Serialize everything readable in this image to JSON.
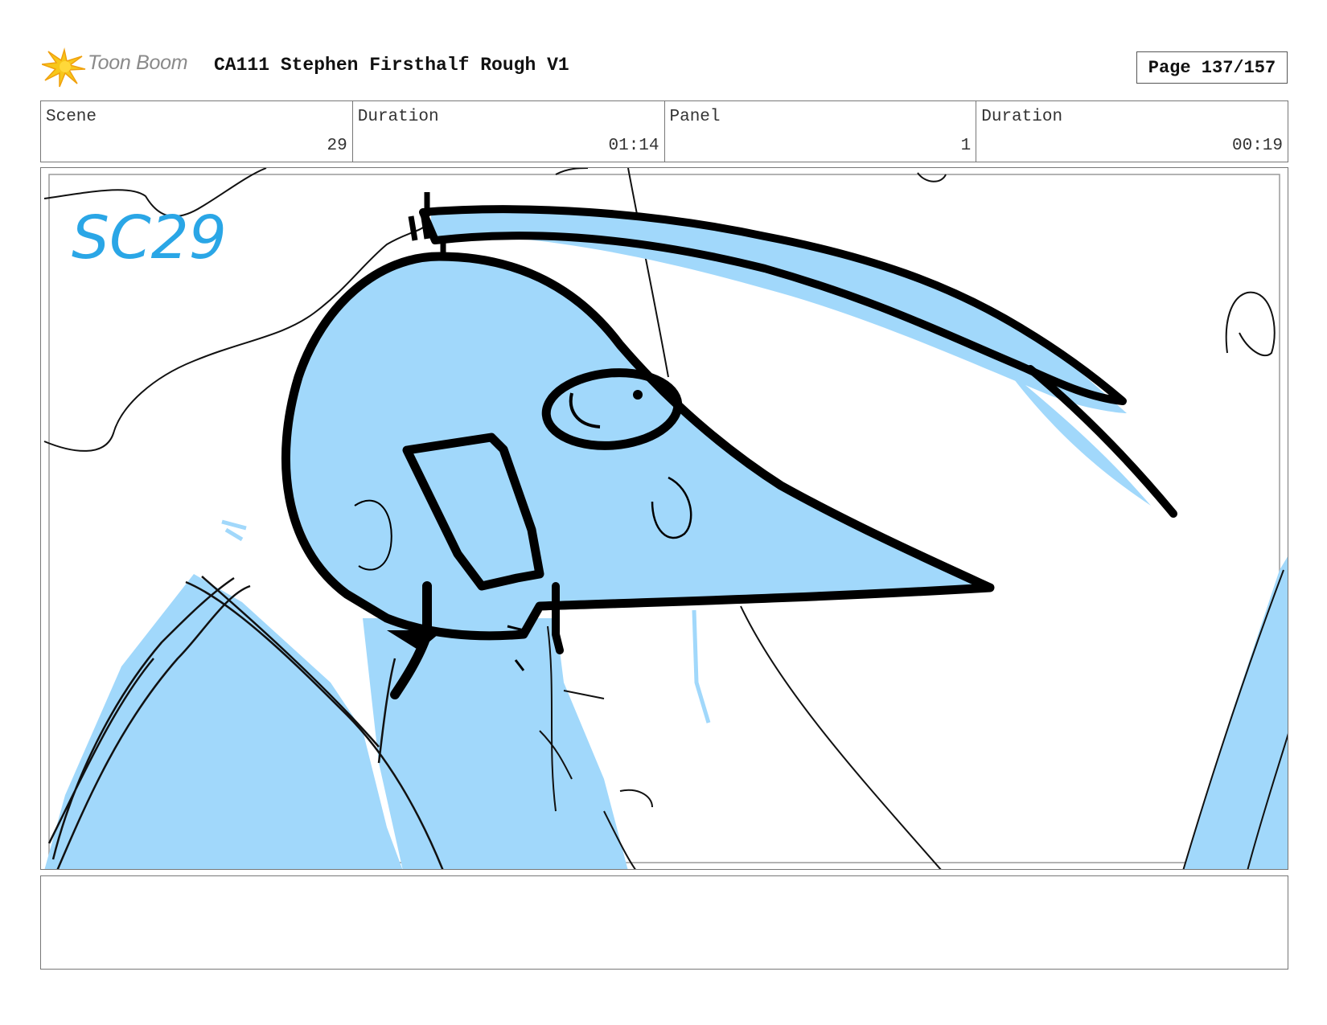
{
  "header": {
    "logo_text": "Toon Boom",
    "title": "CA111 Stephen Firsthalf Rough V1",
    "page": "Page 137/157"
  },
  "info": [
    {
      "label": "Scene",
      "value": "29"
    },
    {
      "label": "Duration",
      "value": "01:14"
    },
    {
      "label": "Panel",
      "value": "1"
    },
    {
      "label": "Duration",
      "value": "00:19"
    }
  ],
  "panel": {
    "scene_note": "SC29",
    "fill_color": "#a1d8fb",
    "ink_color": "#000000",
    "note_color": "#2aa6e6"
  },
  "notes": ""
}
